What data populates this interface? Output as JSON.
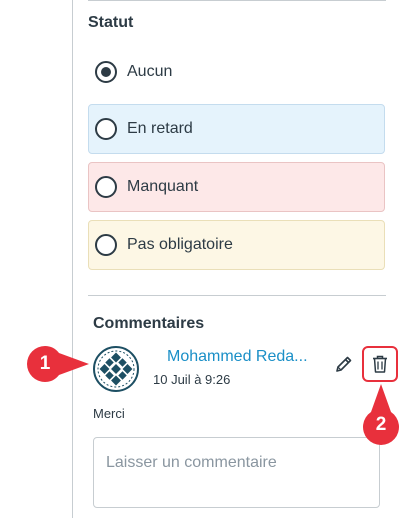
{
  "status": {
    "title": "Statut",
    "options": [
      {
        "label": "Aucun",
        "checked": true
      },
      {
        "label": "En retard",
        "checked": false
      },
      {
        "label": "Manquant",
        "checked": false
      },
      {
        "label": "Pas obligatoire",
        "checked": false
      }
    ]
  },
  "comments": {
    "title": "Commentaires",
    "items": [
      {
        "author": "Mohammed Reda...",
        "date": "10 Juil à 9:26",
        "text": "Merci"
      }
    ],
    "input_placeholder": "Laisser un commentaire"
  },
  "callouts": [
    "1",
    "2"
  ],
  "colors": {
    "accent": "#1a8fc7",
    "callout": "#e8303c",
    "late_bg": "#e5f3fc",
    "missing_bg": "#fde8e8",
    "excused_bg": "#fdf7e5",
    "text": "#2d3b45"
  },
  "icons": [
    "avatar-icon",
    "pencil-icon",
    "trash-icon"
  ]
}
